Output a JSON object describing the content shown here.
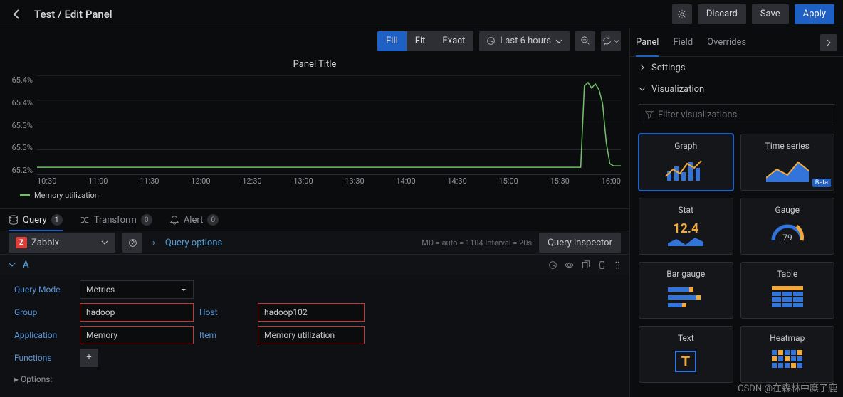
{
  "header": {
    "title": "Test / Edit Panel",
    "discard": "Discard",
    "save": "Save",
    "apply": "Apply"
  },
  "toolbar": {
    "fill": "Fill",
    "fit": "Fit",
    "exact": "Exact",
    "time_range": "Last 6 hours"
  },
  "chart_data": {
    "type": "line",
    "title": "Panel Title",
    "series": [
      {
        "name": "Memory utilization",
        "color": "#73bf69"
      }
    ],
    "ylabel": "",
    "y_ticks": [
      "65.4%",
      "65.4%",
      "65.3%",
      "65.3%",
      "65.2%"
    ],
    "x_ticks": [
      "10:30",
      "11:00",
      "11:30",
      "12:00",
      "12:30",
      "13:00",
      "13:30",
      "14:00",
      "14:30",
      "15:00",
      "15:30",
      "16:00"
    ],
    "ylim": [
      65.2,
      65.45
    ],
    "note": "flat line near 65.22% until ~16:05, spike to ~65.44%, drop to ~65.24%"
  },
  "tabs": {
    "query": "Query",
    "query_count": "1",
    "transform": "Transform",
    "transform_count": "0",
    "alert": "Alert",
    "alert_count": "0"
  },
  "datasource": {
    "name": "Zabbix",
    "query_options": "Query options",
    "md_info": "MD = auto = 1104   Interval = 20s",
    "inspector": "Query inspector"
  },
  "query": {
    "letter": "A",
    "mode_label": "Query Mode",
    "mode_value": "Metrics",
    "group_label": "Group",
    "group_value": "hadoop",
    "host_label": "Host",
    "host_value": "hadoop102",
    "app_label": "Application",
    "app_value": "Memory",
    "item_label": "Item",
    "item_value": "Memory utilization",
    "functions_label": "Functions",
    "options": "Options:"
  },
  "right": {
    "tab_panel": "Panel",
    "tab_field": "Field",
    "tab_overrides": "Overrides",
    "settings": "Settings",
    "visualization": "Visualization",
    "filter_placeholder": "Filter visualizations",
    "viz": {
      "graph": "Graph",
      "timeseries": "Time series",
      "stat": "Stat",
      "stat_value": "12.4",
      "gauge": "Gauge",
      "gauge_value": "79",
      "bargauge": "Bar gauge",
      "table": "Table",
      "text": "Text",
      "heatmap": "Heatmap",
      "beta": "Beta"
    }
  },
  "watermark": "CSDN @在森林中糜了鹿"
}
